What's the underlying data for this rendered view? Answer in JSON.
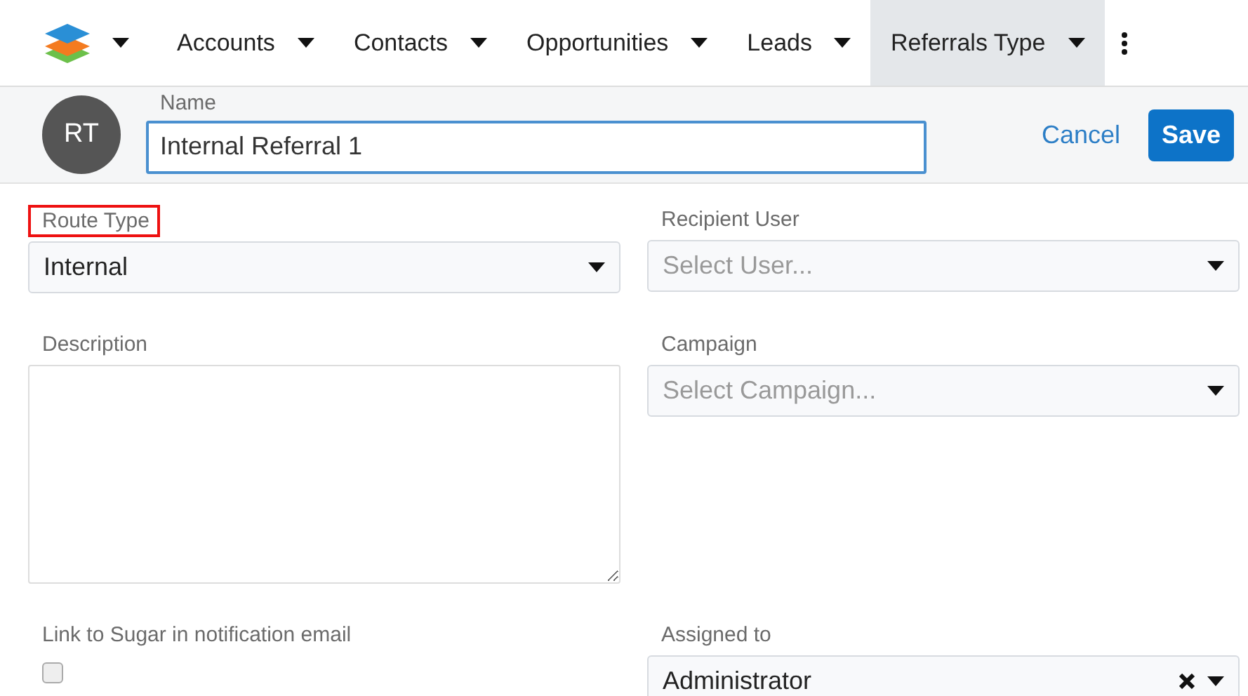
{
  "nav": {
    "tabs": [
      {
        "label": "Accounts",
        "selected": false
      },
      {
        "label": "Contacts",
        "selected": false
      },
      {
        "label": "Opportunities",
        "selected": false
      },
      {
        "label": "Leads",
        "selected": false
      },
      {
        "label": "Referrals Type",
        "selected": true
      }
    ]
  },
  "header": {
    "avatar": "RT",
    "name_label": "Name",
    "name_value": "Internal Referral 1",
    "cancel": "Cancel",
    "save": "Save"
  },
  "form_rows": [
    [
      {
        "kind": "select",
        "label": "Route Type",
        "value": "Internal",
        "highlighted": true
      },
      {
        "kind": "select",
        "label": "Recipient User",
        "placeholder": "Select User...",
        "highlighted": false
      }
    ],
    [
      {
        "kind": "textarea",
        "label": "Description",
        "highlighted": false
      },
      {
        "kind": "select",
        "label": "Campaign",
        "placeholder": "Select Campaign...",
        "highlighted": false
      }
    ],
    [
      {
        "kind": "checkbox",
        "label": "Link to Sugar in notification email",
        "checked": false,
        "highlighted": false
      },
      {
        "kind": "select",
        "label": "Assigned to",
        "value": "Administrator",
        "clearable": true,
        "highlighted": false
      }
    ]
  ]
}
